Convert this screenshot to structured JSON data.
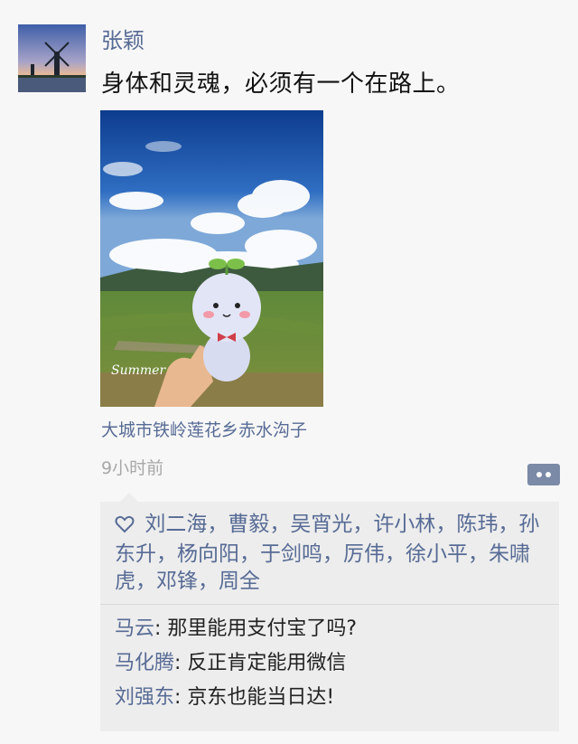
{
  "post": {
    "author": "张颖",
    "text": "身体和灵魂，必须有一个在路上。",
    "location": "大城市铁岭莲花乡赤水沟子",
    "time": "9小时前",
    "photo_caption": "Summer"
  },
  "likes": {
    "names": [
      "刘二海",
      "曹毅",
      "吴宵光",
      "许小林",
      "陈玮",
      "孙东升",
      "杨向阳",
      "于剑鸣",
      "厉伟",
      "徐小平",
      "朱啸虎",
      "邓锋",
      "周全"
    ],
    "separator": "，"
  },
  "comments": [
    {
      "name": "马云",
      "sep": ": ",
      "text": "那里能用支付宝了吗?"
    },
    {
      "name": "马化腾",
      "sep": ": ",
      "text": "反正肯定能用微信"
    },
    {
      "name": "刘强东",
      "sep": ": ",
      "text": "京东也能当日达!"
    }
  ],
  "colors": {
    "link": "#576b95",
    "background": "#f7f7f7",
    "panel": "#ededed",
    "more_button": "#7a8aa7"
  },
  "icons": {
    "avatar": "windmill-landscape",
    "like": "heart-outline-icon",
    "more": "comment-more-icon"
  }
}
